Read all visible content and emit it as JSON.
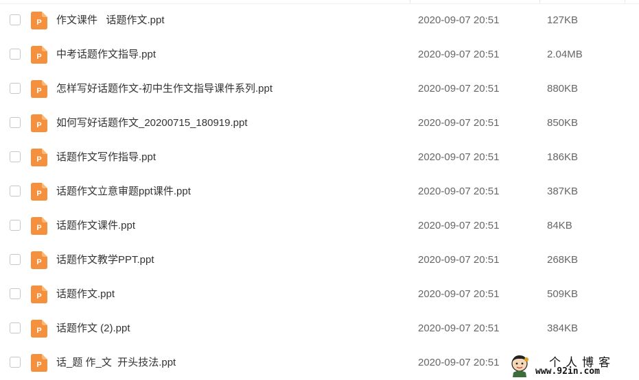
{
  "file_list": {
    "rows": [
      {
        "name": "作文课件   话题作文.ppt",
        "modified": "2020-09-07 20:51",
        "size": "127KB"
      },
      {
        "name": "中考话题作文指导.ppt",
        "modified": "2020-09-07 20:51",
        "size": "2.04MB"
      },
      {
        "name": "怎样写好话题作文-初中生作文指导课件系列.ppt",
        "modified": "2020-09-07 20:51",
        "size": "880KB"
      },
      {
        "name": "如何写好话题作文_20200715_180919.ppt",
        "modified": "2020-09-07 20:51",
        "size": "850KB"
      },
      {
        "name": "话题作文写作指导.ppt",
        "modified": "2020-09-07 20:51",
        "size": "186KB"
      },
      {
        "name": "话题作文立意审题ppt课件.ppt",
        "modified": "2020-09-07 20:51",
        "size": "387KB"
      },
      {
        "name": "话题作文课件.ppt",
        "modified": "2020-09-07 20:51",
        "size": "84KB"
      },
      {
        "name": "话题作文教学PPT.ppt",
        "modified": "2020-09-07 20:51",
        "size": "268KB"
      },
      {
        "name": "话题作文.ppt",
        "modified": "2020-09-07 20:51",
        "size": "509KB"
      },
      {
        "name": "话题作文 (2).ppt",
        "modified": "2020-09-07 20:51",
        "size": "384KB"
      },
      {
        "name": "话_题 作_文  开头技法.ppt",
        "modified": "2020-09-07 20:51",
        "size": ""
      }
    ],
    "file_icon": {
      "name": "ppt-file-icon",
      "letter": "P",
      "color": "#f5913e"
    }
  },
  "watermark": {
    "title": "个人博客",
    "url": "www.92in.com"
  },
  "colors": {
    "name_text": "#333333",
    "meta_text": "#666666",
    "checkbox_border": "#c6c6c6"
  }
}
